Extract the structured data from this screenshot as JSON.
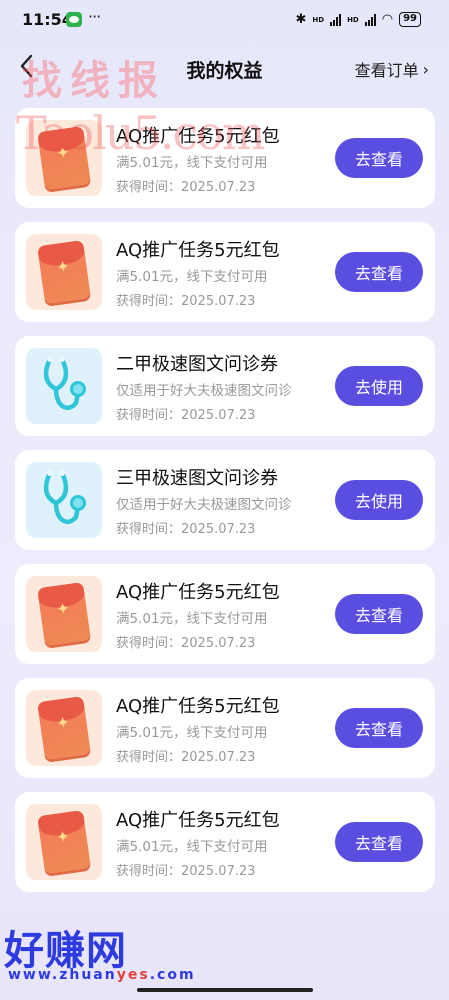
{
  "status_bar": {
    "time": "11:54",
    "battery": "99",
    "signal_label_1": "HD",
    "signal_label_2": "HD"
  },
  "nav": {
    "title": "我的权益",
    "orders_link": "查看订单",
    "chevron": "›"
  },
  "watermarks": {
    "top": "找线报",
    "url": "Taolu5.com",
    "bottom": "好赚网",
    "bottom_url_prefix": "www.zhuan",
    "bottom_url_highlight": "yes",
    "bottom_url_suffix": ".com"
  },
  "items": [
    {
      "type": "redpacket",
      "title": "AQ推广任务5元红包",
      "desc": "满5.01元，线下支付可用",
      "time": "获得时间：2025.07.23",
      "button": "去查看"
    },
    {
      "type": "redpacket",
      "title": "AQ推广任务5元红包",
      "desc": "满5.01元，线下支付可用",
      "time": "获得时间：2025.07.23",
      "button": "去查看"
    },
    {
      "type": "stethoscope",
      "title": "二甲极速图文问诊券",
      "desc": "仅适用于好大夫极速图文问诊",
      "time": "获得时间：2025.07.23",
      "button": "去使用"
    },
    {
      "type": "stethoscope",
      "title": "三甲极速图文问诊券",
      "desc": "仅适用于好大夫极速图文问诊",
      "time": "获得时间：2025.07.23",
      "button": "去使用"
    },
    {
      "type": "redpacket",
      "title": "AQ推广任务5元红包",
      "desc": "满5.01元，线下支付可用",
      "time": "获得时间：2025.07.23",
      "button": "去查看"
    },
    {
      "type": "redpacket",
      "title": "AQ推广任务5元红包",
      "desc": "满5.01元，线下支付可用",
      "time": "获得时间：2025.07.23",
      "button": "去查看"
    },
    {
      "type": "redpacket",
      "title": "AQ推广任务5元红包",
      "desc": "满5.01元，线下支付可用",
      "time": "获得时间：2025.07.23",
      "button": "去查看"
    }
  ],
  "colors": {
    "accent": "#5a4ee0",
    "background": "#ece9fb"
  }
}
